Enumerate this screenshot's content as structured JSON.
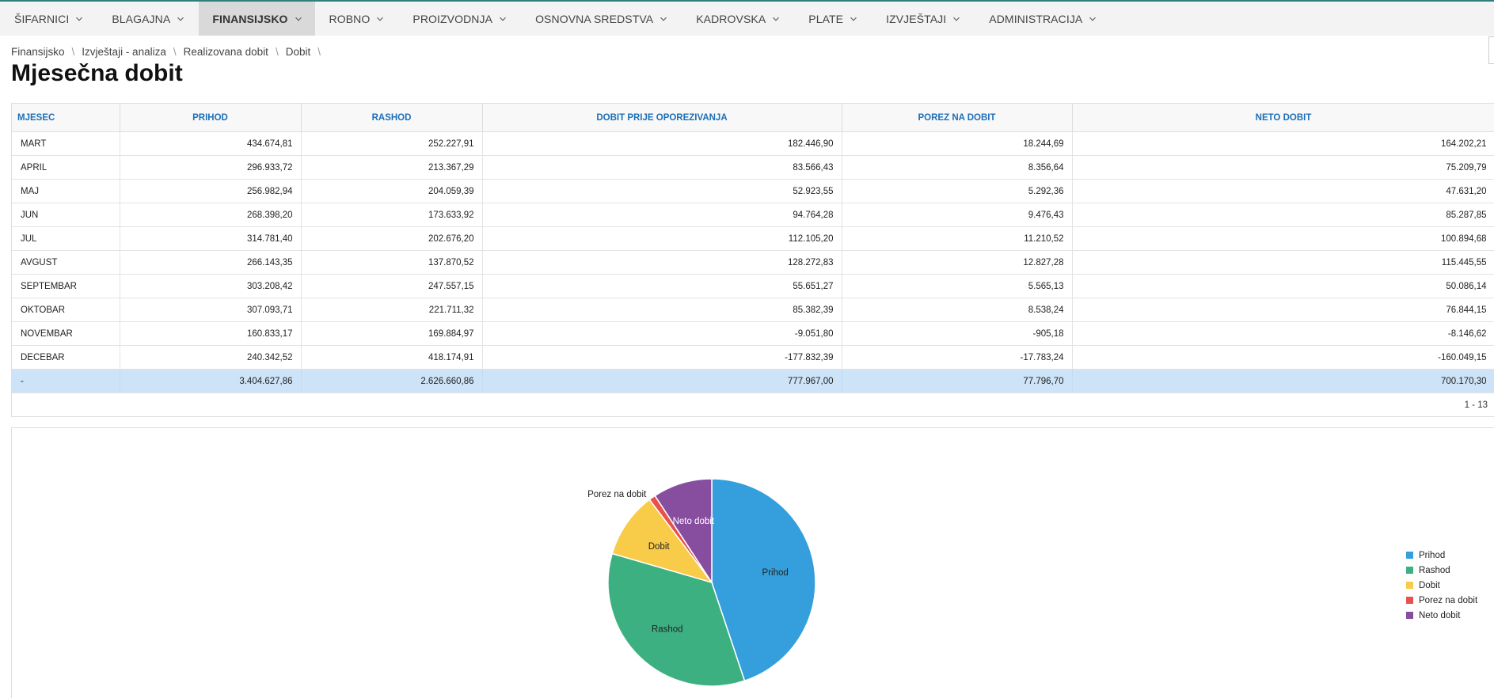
{
  "nav": {
    "items": [
      {
        "label": "ŠIFARNICI",
        "active": false
      },
      {
        "label": "BLAGAJNA",
        "active": false
      },
      {
        "label": "FINANSIJSKO",
        "active": true
      },
      {
        "label": "ROBNO",
        "active": false
      },
      {
        "label": "PROIZVODNJA",
        "active": false
      },
      {
        "label": "OSNOVNA SREDSTVA",
        "active": false
      },
      {
        "label": "KADROVSKA",
        "active": false
      },
      {
        "label": "PLATE",
        "active": false
      },
      {
        "label": "IZVJEŠTAJI",
        "active": false
      },
      {
        "label": "ADMINISTRACIJA",
        "active": false
      }
    ]
  },
  "breadcrumb": {
    "items": [
      "Finansijsko",
      "Izvještaji - analiza",
      "Realizovana dobit",
      "Dobit"
    ],
    "separator": "\\"
  },
  "page": {
    "title": "Mjesečna dobit"
  },
  "grid": {
    "columns": [
      "MJESEC",
      "PRIHOD",
      "RASHOD",
      "DOBIT PRIJE OPOREZIVANJA",
      "POREZ NA DOBIT",
      "NETO DOBIT"
    ],
    "rows": [
      [
        "MART",
        "434.674,81",
        "252.227,91",
        "182.446,90",
        "18.244,69",
        "164.202,21"
      ],
      [
        "APRIL",
        "296.933,72",
        "213.367,29",
        "83.566,43",
        "8.356,64",
        "75.209,79"
      ],
      [
        "MAJ",
        "256.982,94",
        "204.059,39",
        "52.923,55",
        "5.292,36",
        "47.631,20"
      ],
      [
        "JUN",
        "268.398,20",
        "173.633,92",
        "94.764,28",
        "9.476,43",
        "85.287,85"
      ],
      [
        "JUL",
        "314.781,40",
        "202.676,20",
        "112.105,20",
        "11.210,52",
        "100.894,68"
      ],
      [
        "AVGUST",
        "266.143,35",
        "137.870,52",
        "128.272,83",
        "12.827,28",
        "115.445,55"
      ],
      [
        "SEPTEMBAR",
        "303.208,42",
        "247.557,15",
        "55.651,27",
        "5.565,13",
        "50.086,14"
      ],
      [
        "OKTOBAR",
        "307.093,71",
        "221.711,32",
        "85.382,39",
        "8.538,24",
        "76.844,15"
      ],
      [
        "NOVEMBAR",
        "160.833,17",
        "169.884,97",
        "-9.051,80",
        "-905,18",
        "-8.146,62"
      ],
      [
        "DECEBAR",
        "240.342,52",
        "418.174,91",
        "-177.832,39",
        "-17.783,24",
        "-160.049,15"
      ]
    ],
    "total": [
      "-",
      "3.404.627,86",
      "2.626.660,86",
      "777.967,00",
      "77.796,70",
      "700.170,30"
    ],
    "pager_text": "1 - 13"
  },
  "chart_data": {
    "type": "pie",
    "labels": [
      "Prihod",
      "Rashod",
      "Dobit",
      "Porez na dobit",
      "Neto dobit"
    ],
    "values": [
      3404627.86,
      2626660.86,
      777967.0,
      77796.7,
      700170.3
    ],
    "colors": [
      "#349fdc",
      "#3db081",
      "#f8cb48",
      "#e8514c",
      "#874ea0"
    ],
    "legend": "right"
  }
}
